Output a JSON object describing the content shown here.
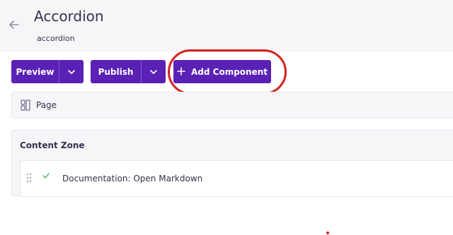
{
  "header": {
    "title": "Accordion",
    "subtitle": "accordion",
    "back_icon": "arrow-left-icon"
  },
  "toolbar": {
    "preview_label": "Preview",
    "publish_label": "Publish",
    "add_component_label": "Add Component",
    "accent_color": "#5b21b6"
  },
  "page_row": {
    "label": "Page"
  },
  "content_zone": {
    "title": "Content Zone",
    "items": [
      {
        "label": "Documentation: Open Markdown",
        "status_icon": "check-icon"
      }
    ]
  },
  "annotation": {
    "color": "#d42020"
  }
}
